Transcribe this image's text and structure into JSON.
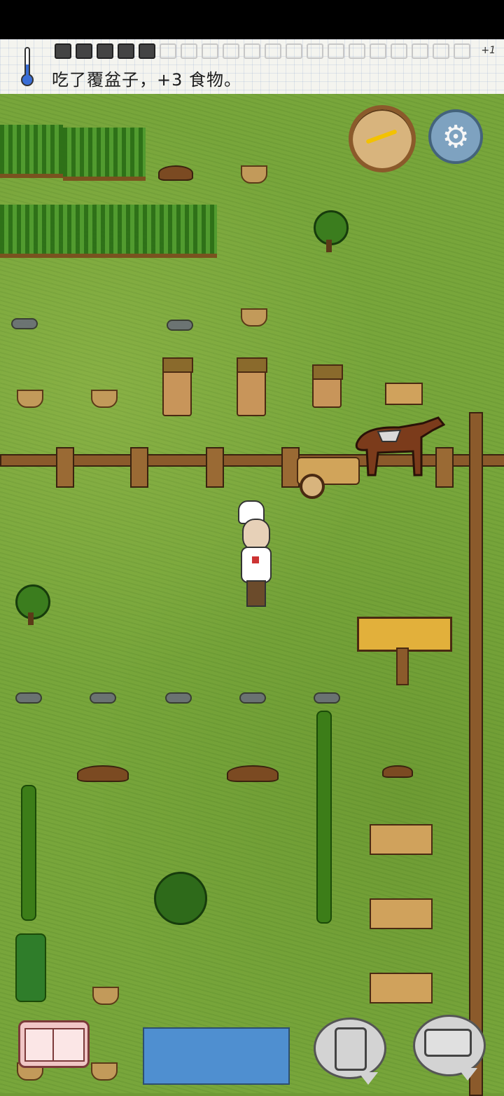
{
  "status": {
    "food_pips_filled": 5,
    "food_pips_total": 20,
    "bonus": "+1",
    "message": "吃了覆盆子，+3 食物。"
  },
  "controls": {
    "compass": "compass-icon",
    "settings": "gear-icon",
    "tech_book": "book-icon",
    "emote": "puppet-icon",
    "chat": "keyboard-icon"
  },
  "colors": {
    "grass": "#78a63b",
    "note_bg": "#f4f4ef",
    "wood": "#8b5a2b",
    "water": "#4f8fd0"
  }
}
